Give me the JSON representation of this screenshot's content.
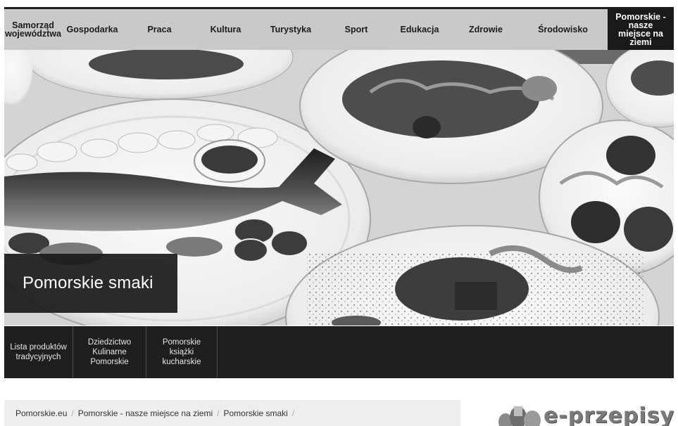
{
  "nav": {
    "items": [
      {
        "label": "Samorząd województwa"
      },
      {
        "label": "Gospodarka"
      },
      {
        "label": "Praca"
      },
      {
        "label": "Kultura"
      },
      {
        "label": "Turystyka"
      },
      {
        "label": "Sport"
      },
      {
        "label": "Edukacja"
      },
      {
        "label": "Zdrowie"
      },
      {
        "label": "Środowisko"
      },
      {
        "label": "Pomorskie - nasze miejsce na ziemi"
      }
    ],
    "active_index": 9
  },
  "hero": {
    "title": "Pomorskie smaki"
  },
  "subnav": {
    "items": [
      {
        "label": "Lista produktów tradycyjnych"
      },
      {
        "label": "Dziedzictwo Kulinarne Pomorskie"
      },
      {
        "label": "Pomorskie książki kucharskie"
      }
    ]
  },
  "breadcrumb": {
    "items": [
      "Pomorskie.eu",
      "Pomorskie - nasze miejsce na ziemi",
      "Pomorskie smaki"
    ],
    "separator": "/"
  },
  "logo": {
    "text": "e-przepisy"
  },
  "colors": {
    "nav_bg": "#c9c9c9",
    "nav_active_bg": "#1a1a1a",
    "subnav_bg": "#1e1e1e",
    "breadcrumb_bg": "#eeeeee"
  }
}
